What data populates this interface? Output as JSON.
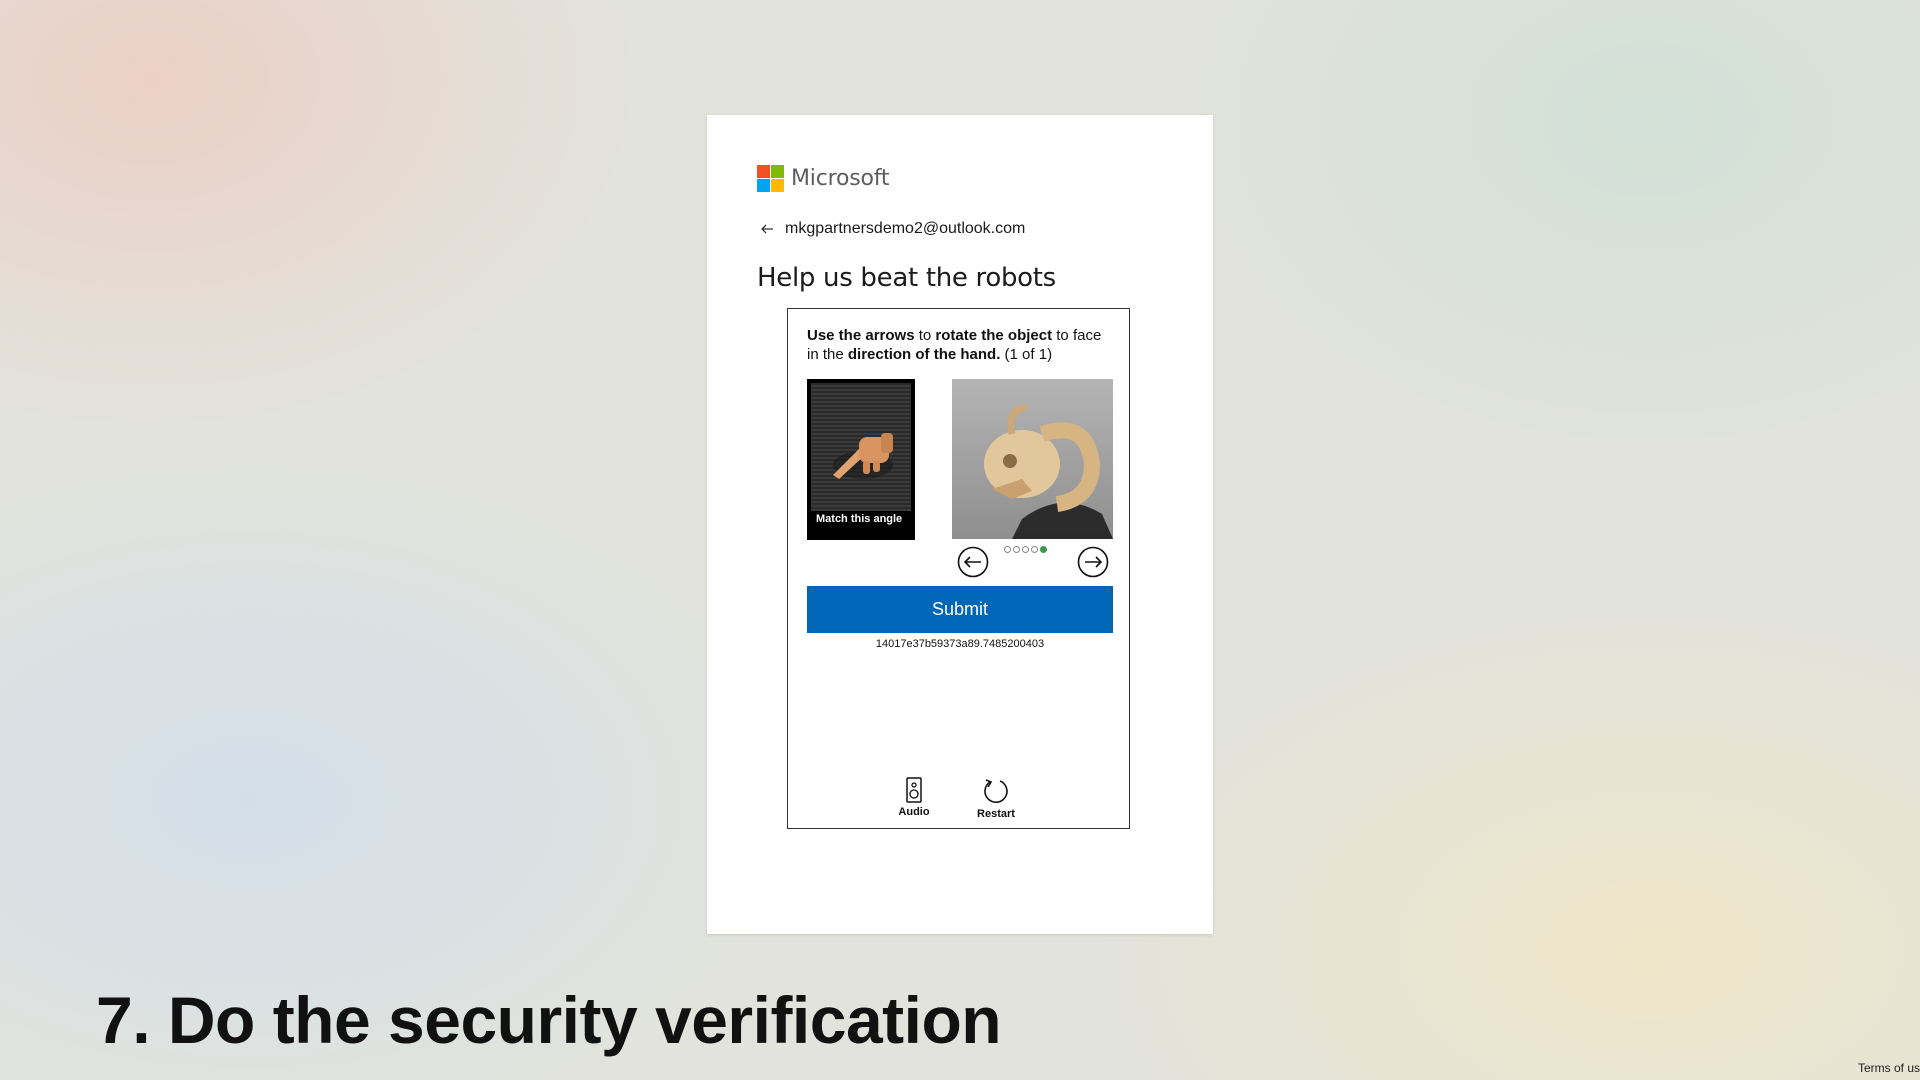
{
  "brand": {
    "name": "Microsoft",
    "colors": [
      "#f25022",
      "#7fba00",
      "#00a4ef",
      "#ffb900"
    ]
  },
  "identity": {
    "back_icon": "back-arrow-icon",
    "email": "mkgpartnersdemo2@outlook.com"
  },
  "heading": "Help us beat the robots",
  "captcha": {
    "instruction": {
      "p1": "Use the arrows",
      "p2": " to ",
      "p3": "rotate the object",
      "p4": " to face in the ",
      "p5": "direction of the hand.",
      "p6": " (1 of 1)"
    },
    "reference_label": "Match this angle",
    "progress": {
      "total": 5,
      "active_index": 4
    },
    "arrow_left_icon": "arrow-left-circle-icon",
    "arrow_right_icon": "arrow-right-circle-icon",
    "submit_label": "Submit",
    "session_id": "14017e37b59373a89.7485200403",
    "tools": {
      "audio_label": "Audio",
      "restart_label": "Restart"
    },
    "accent_color": "#0067b8",
    "active_dot_color": "#3a9a4a"
  },
  "slide_title": "7. Do the security verification",
  "footer": {
    "terms": "Terms of us"
  }
}
